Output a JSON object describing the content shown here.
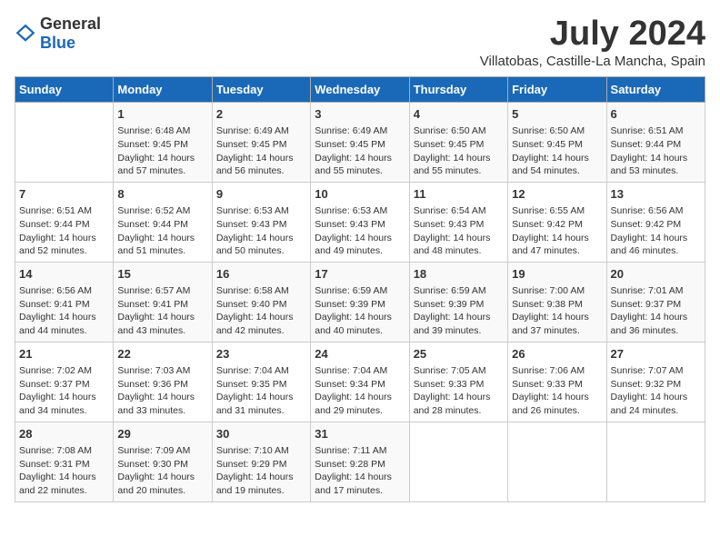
{
  "header": {
    "logo_general": "General",
    "logo_blue": "Blue",
    "month": "July 2024",
    "location": "Villatobas, Castille-La Mancha, Spain"
  },
  "days_of_week": [
    "Sunday",
    "Monday",
    "Tuesday",
    "Wednesday",
    "Thursday",
    "Friday",
    "Saturday"
  ],
  "weeks": [
    [
      {
        "day": "",
        "info": ""
      },
      {
        "day": "1",
        "info": "Sunrise: 6:48 AM\nSunset: 9:45 PM\nDaylight: 14 hours\nand 57 minutes."
      },
      {
        "day": "2",
        "info": "Sunrise: 6:49 AM\nSunset: 9:45 PM\nDaylight: 14 hours\nand 56 minutes."
      },
      {
        "day": "3",
        "info": "Sunrise: 6:49 AM\nSunset: 9:45 PM\nDaylight: 14 hours\nand 55 minutes."
      },
      {
        "day": "4",
        "info": "Sunrise: 6:50 AM\nSunset: 9:45 PM\nDaylight: 14 hours\nand 55 minutes."
      },
      {
        "day": "5",
        "info": "Sunrise: 6:50 AM\nSunset: 9:45 PM\nDaylight: 14 hours\nand 54 minutes."
      },
      {
        "day": "6",
        "info": "Sunrise: 6:51 AM\nSunset: 9:44 PM\nDaylight: 14 hours\nand 53 minutes."
      }
    ],
    [
      {
        "day": "7",
        "info": "Sunrise: 6:51 AM\nSunset: 9:44 PM\nDaylight: 14 hours\nand 52 minutes."
      },
      {
        "day": "8",
        "info": "Sunrise: 6:52 AM\nSunset: 9:44 PM\nDaylight: 14 hours\nand 51 minutes."
      },
      {
        "day": "9",
        "info": "Sunrise: 6:53 AM\nSunset: 9:43 PM\nDaylight: 14 hours\nand 50 minutes."
      },
      {
        "day": "10",
        "info": "Sunrise: 6:53 AM\nSunset: 9:43 PM\nDaylight: 14 hours\nand 49 minutes."
      },
      {
        "day": "11",
        "info": "Sunrise: 6:54 AM\nSunset: 9:43 PM\nDaylight: 14 hours\nand 48 minutes."
      },
      {
        "day": "12",
        "info": "Sunrise: 6:55 AM\nSunset: 9:42 PM\nDaylight: 14 hours\nand 47 minutes."
      },
      {
        "day": "13",
        "info": "Sunrise: 6:56 AM\nSunset: 9:42 PM\nDaylight: 14 hours\nand 46 minutes."
      }
    ],
    [
      {
        "day": "14",
        "info": "Sunrise: 6:56 AM\nSunset: 9:41 PM\nDaylight: 14 hours\nand 44 minutes."
      },
      {
        "day": "15",
        "info": "Sunrise: 6:57 AM\nSunset: 9:41 PM\nDaylight: 14 hours\nand 43 minutes."
      },
      {
        "day": "16",
        "info": "Sunrise: 6:58 AM\nSunset: 9:40 PM\nDaylight: 14 hours\nand 42 minutes."
      },
      {
        "day": "17",
        "info": "Sunrise: 6:59 AM\nSunset: 9:39 PM\nDaylight: 14 hours\nand 40 minutes."
      },
      {
        "day": "18",
        "info": "Sunrise: 6:59 AM\nSunset: 9:39 PM\nDaylight: 14 hours\nand 39 minutes."
      },
      {
        "day": "19",
        "info": "Sunrise: 7:00 AM\nSunset: 9:38 PM\nDaylight: 14 hours\nand 37 minutes."
      },
      {
        "day": "20",
        "info": "Sunrise: 7:01 AM\nSunset: 9:37 PM\nDaylight: 14 hours\nand 36 minutes."
      }
    ],
    [
      {
        "day": "21",
        "info": "Sunrise: 7:02 AM\nSunset: 9:37 PM\nDaylight: 14 hours\nand 34 minutes."
      },
      {
        "day": "22",
        "info": "Sunrise: 7:03 AM\nSunset: 9:36 PM\nDaylight: 14 hours\nand 33 minutes."
      },
      {
        "day": "23",
        "info": "Sunrise: 7:04 AM\nSunset: 9:35 PM\nDaylight: 14 hours\nand 31 minutes."
      },
      {
        "day": "24",
        "info": "Sunrise: 7:04 AM\nSunset: 9:34 PM\nDaylight: 14 hours\nand 29 minutes."
      },
      {
        "day": "25",
        "info": "Sunrise: 7:05 AM\nSunset: 9:33 PM\nDaylight: 14 hours\nand 28 minutes."
      },
      {
        "day": "26",
        "info": "Sunrise: 7:06 AM\nSunset: 9:33 PM\nDaylight: 14 hours\nand 26 minutes."
      },
      {
        "day": "27",
        "info": "Sunrise: 7:07 AM\nSunset: 9:32 PM\nDaylight: 14 hours\nand 24 minutes."
      }
    ],
    [
      {
        "day": "28",
        "info": "Sunrise: 7:08 AM\nSunset: 9:31 PM\nDaylight: 14 hours\nand 22 minutes."
      },
      {
        "day": "29",
        "info": "Sunrise: 7:09 AM\nSunset: 9:30 PM\nDaylight: 14 hours\nand 20 minutes."
      },
      {
        "day": "30",
        "info": "Sunrise: 7:10 AM\nSunset: 9:29 PM\nDaylight: 14 hours\nand 19 minutes."
      },
      {
        "day": "31",
        "info": "Sunrise: 7:11 AM\nSunset: 9:28 PM\nDaylight: 14 hours\nand 17 minutes."
      },
      {
        "day": "",
        "info": ""
      },
      {
        "day": "",
        "info": ""
      },
      {
        "day": "",
        "info": ""
      }
    ]
  ]
}
